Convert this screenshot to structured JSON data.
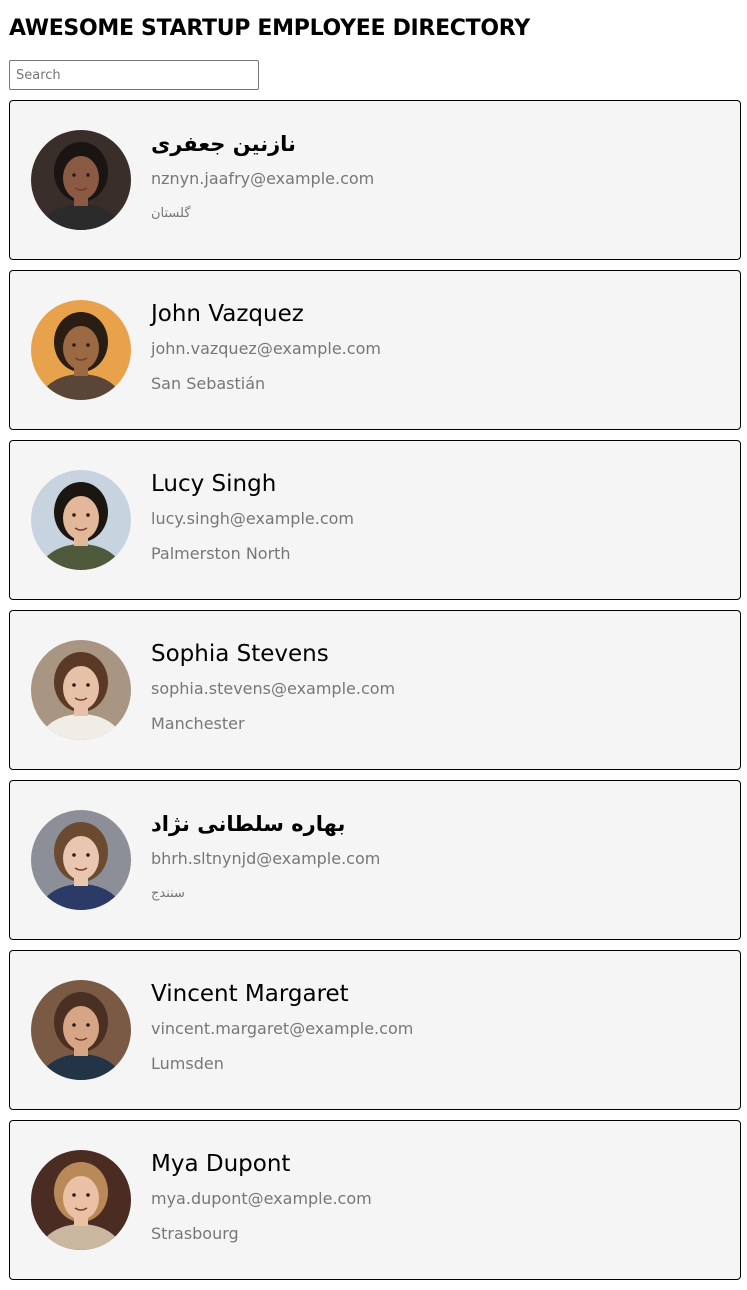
{
  "header": {
    "title": "AWESOME STARTUP EMPLOYEE DIRECTORY"
  },
  "search": {
    "placeholder": "Search",
    "value": ""
  },
  "employees": [
    {
      "name": "نازنین جعفری",
      "email": "nznyn.jaafry@example.com",
      "city": "گلستان",
      "rtl": true,
      "avatar": {
        "skin": "#8a5a44",
        "hair": "#1a1413",
        "bg": "#3a2e2b",
        "shirt": "#2b2b2b"
      }
    },
    {
      "name": "John Vazquez",
      "email": "john.vazquez@example.com",
      "city": "San Sebastián",
      "rtl": false,
      "avatar": {
        "skin": "#9c6a42",
        "hair": "#2a1d14",
        "bg": "#e9a24c",
        "shirt": "#5a4638"
      }
    },
    {
      "name": "Lucy Singh",
      "email": "lucy.singh@example.com",
      "city": "Palmerston North",
      "rtl": false,
      "avatar": {
        "skin": "#e2b79a",
        "hair": "#1c1612",
        "bg": "#c7d3de",
        "shirt": "#4f5a3c"
      }
    },
    {
      "name": "Sophia Stevens",
      "email": "sophia.stevens@example.com",
      "city": "Manchester",
      "rtl": false,
      "avatar": {
        "skin": "#e6c1a8",
        "hair": "#5a3a26",
        "bg": "#a89683",
        "shirt": "#f0ece6"
      }
    },
    {
      "name": "بهاره سلطانی نژاد",
      "email": "bhrh.sltnynjd@example.com",
      "city": "سنندج",
      "rtl": true,
      "avatar": {
        "skin": "#e9c6b0",
        "hair": "#6b4a30",
        "bg": "#8c8f98",
        "shirt": "#2b3a66"
      }
    },
    {
      "name": "Vincent Margaret",
      "email": "vincent.margaret@example.com",
      "city": "Lumsden",
      "rtl": false,
      "avatar": {
        "skin": "#d6a585",
        "hair": "#4a3022",
        "bg": "#7a5a44",
        "shirt": "#243447"
      }
    },
    {
      "name": "Mya Dupont",
      "email": "mya.dupont@example.com",
      "city": "Strasbourg",
      "rtl": false,
      "avatar": {
        "skin": "#eac1a5",
        "hair": "#b98a58",
        "bg": "#4a2c22",
        "shirt": "#c9b7a0"
      }
    }
  ]
}
